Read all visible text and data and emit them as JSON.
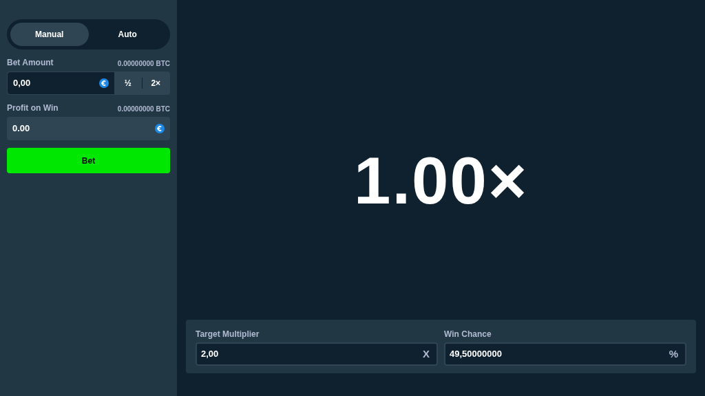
{
  "mode_tabs": [
    {
      "label": "Manual",
      "selected": true
    },
    {
      "label": "Auto",
      "selected": false
    }
  ],
  "bet_amount": {
    "label": "Bet Amount",
    "conversion": "0.00000000 BTC",
    "value": "0,00",
    "half": "½",
    "double": "2×"
  },
  "profit_on_win": {
    "label": "Profit on Win",
    "conversion": "0.00000000 BTC",
    "value": "0.00"
  },
  "bet_button": "Bet",
  "multiplier": "1.00×",
  "controls": [
    {
      "label": "Target Multiplier",
      "value": "2,00",
      "suffix": "X"
    },
    {
      "label": "Win Chance",
      "value": "49,50000000",
      "suffix": "%"
    }
  ]
}
